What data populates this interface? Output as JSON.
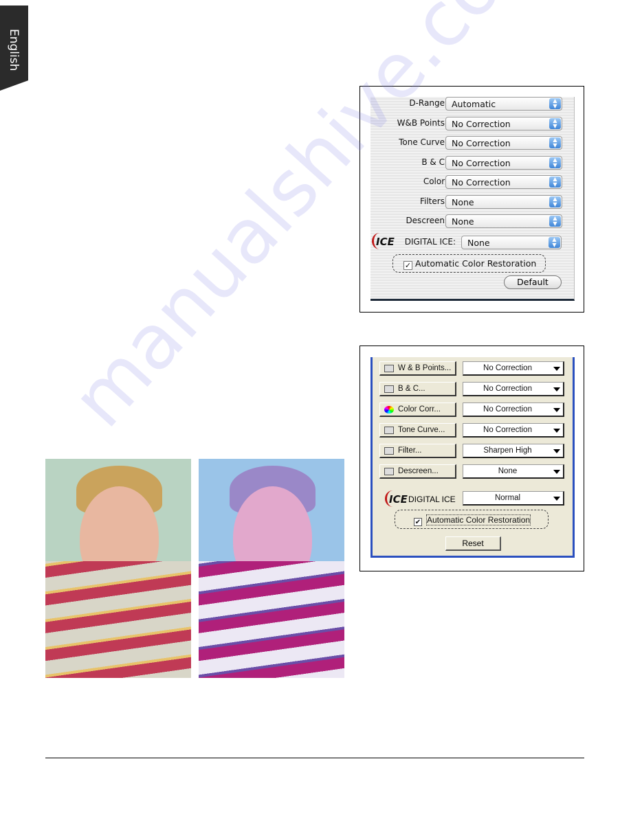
{
  "side_tab": {
    "label": "English"
  },
  "mac_panel": {
    "rows": [
      {
        "label": "D-Range:",
        "value": "Automatic"
      },
      {
        "label": "W&B Points:",
        "value": "No Correction"
      },
      {
        "label": "Tone Curve:",
        "value": "No Correction"
      },
      {
        "label": "B & C:",
        "value": "No Correction"
      },
      {
        "label": "Color:",
        "value": "No Correction"
      },
      {
        "label": "Filters:",
        "value": "None"
      },
      {
        "label": "Descreen:",
        "value": "None"
      }
    ],
    "ice_logo": "ICE",
    "ice_label": "DIGITAL ICE:",
    "ice_value": "None",
    "checkbox_label": "Automatic Color Restoration",
    "checkbox_checked": true,
    "default_button": "Default"
  },
  "win_panel": {
    "rows": [
      {
        "button": "W & B Points...",
        "icon": "wb-points-icon",
        "value": "No Correction"
      },
      {
        "button": "B & C...",
        "icon": "brightness-contrast-icon",
        "value": "No Correction"
      },
      {
        "button": "Color Corr...",
        "icon": "color-wheel-icon",
        "value": "No Correction"
      },
      {
        "button": "Tone Curve...",
        "icon": "tone-curve-icon",
        "value": "No Correction"
      },
      {
        "button": "Filter...",
        "icon": "filter-icon",
        "value": "Sharpen High"
      },
      {
        "button": "Descreen...",
        "icon": "descreen-icon",
        "value": "None"
      }
    ],
    "ice_logo": "ICE",
    "ice_label": "DIGITAL ICE",
    "ice_value": "Normal",
    "checkbox_label": "Automatic Color Restoration",
    "checkbox_checked": true,
    "reset_button": "Reset"
  },
  "watermark": "manualshive.com"
}
